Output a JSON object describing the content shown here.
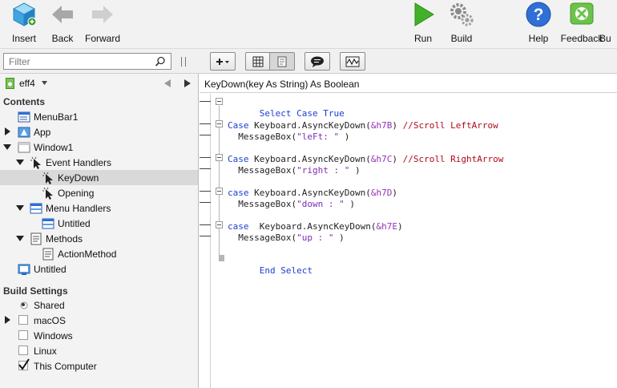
{
  "toolbar": {
    "insert": "Insert",
    "back": "Back",
    "forward": "Forward",
    "run": "Run",
    "build": "Build",
    "help": "Help",
    "feedback": "Feedback",
    "overflow": "Bu"
  },
  "filter": {
    "placeholder": "Filter"
  },
  "project": {
    "name": "eff4"
  },
  "nav": {
    "contents_heading": "Contents",
    "menubar": "MenuBar1",
    "app": "App",
    "window": "Window1",
    "event_handlers": "Event Handlers",
    "keydown": "KeyDown",
    "opening": "Opening",
    "menu_handlers": "Menu Handlers",
    "menu_untitled": "Untitled",
    "methods": "Methods",
    "action_method": "ActionMethod",
    "untitled": "Untitled",
    "build_settings_heading": "Build Settings",
    "shared": "Shared",
    "macos": "macOS",
    "windows": "Windows",
    "linux": "Linux",
    "this_computer": "This Computer"
  },
  "editor": {
    "signature": "KeyDown(key As String) As Boolean",
    "lines": [
      {
        "kw1": "Select Case True"
      },
      {
        "kw1": "Case",
        "call": " Keyboard.AsyncKeyDown(",
        "hex": "&h7B",
        "close": ") ",
        "comment": "//Scroll LeftArrow"
      },
      {
        "call": "  MessageBox(",
        "str": "\"leFt: \"",
        "close": " )"
      },
      {
        "kw1": "Case",
        "call": " Keyboard.AsyncKeyDown(",
        "hex": "&h7C",
        "close": ") ",
        "comment": "//Scroll RightArrow"
      },
      {
        "call": "  MessageBox(",
        "str": "\"right : \"",
        "close": " )"
      },
      {
        "kw1": "case",
        "call": " Keyboard.AsyncKeyDown(",
        "hex": "&h7D",
        "close": ")"
      },
      {
        "call": "  MessageBox(",
        "str": "\"down : \"",
        "close": " )"
      },
      {
        "kw1": "case",
        "call": "  Keyboard.AsyncKeyDown(",
        "hex": "&h7E",
        "close": ")"
      },
      {
        "call": "  MessageBox(",
        "str": "\"up : \"",
        "close": " )"
      },
      {
        "kw1": "End Select"
      }
    ]
  }
}
